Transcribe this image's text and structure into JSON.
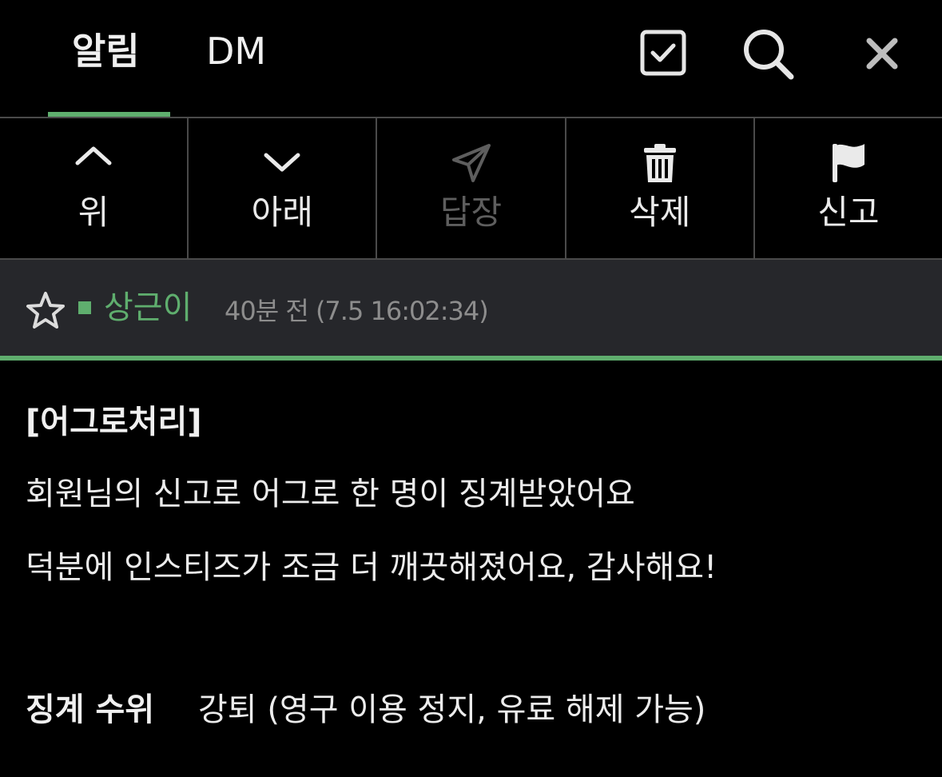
{
  "header": {
    "tabs": [
      {
        "label": "알림",
        "active": true
      },
      {
        "label": "DM",
        "active": false
      }
    ],
    "icons": [
      "checkbox-icon",
      "search-icon",
      "close-icon"
    ],
    "accent_color": "#5fae6e"
  },
  "toolbar": {
    "up_label": "위",
    "down_label": "아래",
    "reply_label": "답장",
    "delete_label": "삭제",
    "report_label": "신고"
  },
  "message": {
    "sender": "상근이",
    "time": "40분 전 (7.5 16:02:34)",
    "title": "[어그로처리]",
    "lines": [
      "회원님의 신고로 어그로 한 명이 징계받았어요",
      "덕분에 인스티즈가 조금 더 깨끗해졌어요, 감사해요!"
    ],
    "penalty_label": "징계 수위",
    "penalty_value": "강퇴 (영구 이용 정지, 유료 해제 가능)"
  }
}
